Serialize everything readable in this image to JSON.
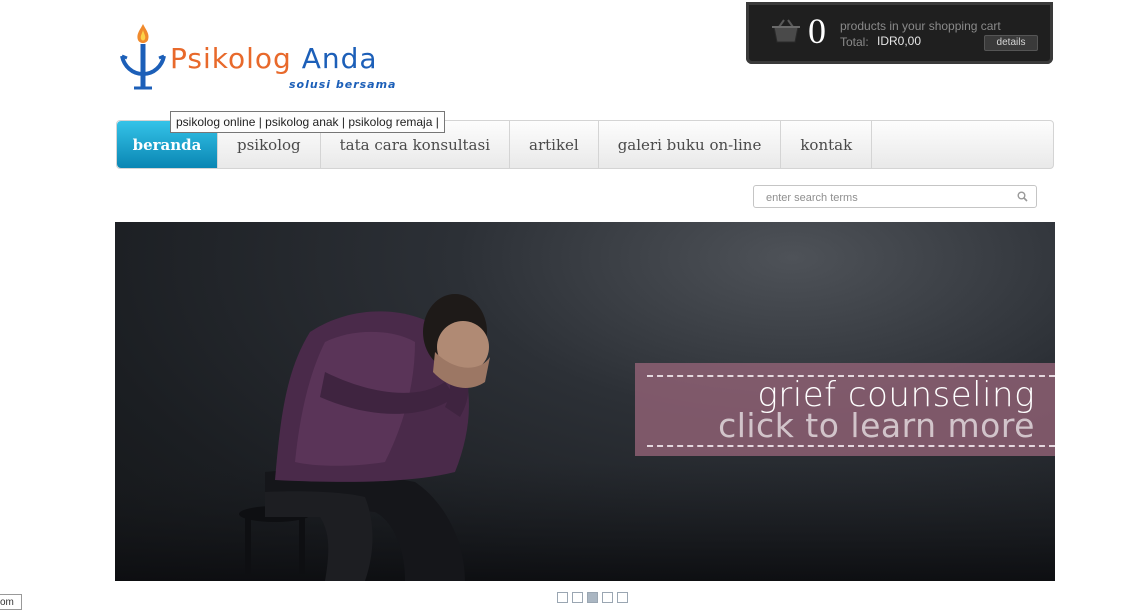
{
  "logo": {
    "title_part1": "Psikolog",
    "title_part2": "Anda",
    "tagline": "solusi bersama",
    "icon": "psi-lotus-icon"
  },
  "cart": {
    "count": "0",
    "text": "products in your shopping cart",
    "total_label": "Total:",
    "total_value": "IDR0,00",
    "details_label": "details",
    "icon": "basket-icon"
  },
  "tooltip": {
    "text": "psikolog online | psikolog anak | psikolog remaja |"
  },
  "nav": {
    "items": [
      {
        "label": "beranda",
        "active": true
      },
      {
        "label": "psikolog"
      },
      {
        "label": "tata cara konsultasi"
      },
      {
        "label": "artikel"
      },
      {
        "label": "galeri buku on-line"
      },
      {
        "label": "kontak"
      }
    ]
  },
  "search": {
    "placeholder": "enter search terms",
    "icon": "search-icon"
  },
  "banner": {
    "title": "grief counseling",
    "subtitle": "click to learn more"
  },
  "slider": {
    "count": 5,
    "active_index": 2
  },
  "status": {
    "fragment": "om"
  },
  "colors": {
    "nav_active": "#1a9fd0",
    "logo_orange": "#e8692b",
    "logo_blue": "#1c5fb8",
    "banner_box": "#96647a"
  }
}
